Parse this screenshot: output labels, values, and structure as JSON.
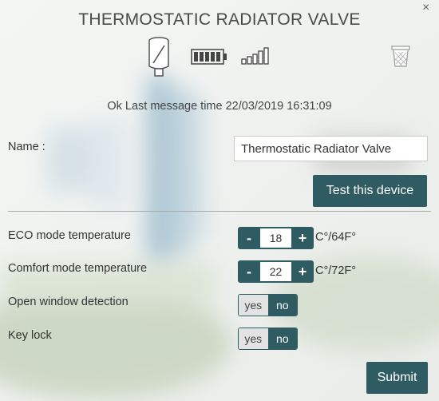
{
  "header": {
    "title": "THERMOSTATIC RADIATOR VALVE",
    "close_glyph": "×"
  },
  "device_icons": {
    "device": "thermostatic-valve-icon",
    "battery": "battery-icon",
    "battery_level": 1.0,
    "signal": "signal-strength-icon",
    "signal_level": 1.0,
    "delete": "trash-icon"
  },
  "status": {
    "text": "Ok Last message time 22/03/2019 16:31:09"
  },
  "name": {
    "label": "Name :",
    "value": "Thermostatic Radiator Valve"
  },
  "test_button": {
    "label": "Test this device"
  },
  "eco": {
    "label": "ECO mode temperature",
    "value": "18",
    "unit": "C°/64F°",
    "minus": "-",
    "plus": "+"
  },
  "comfort": {
    "label": "Comfort mode temperature",
    "value": "22",
    "unit": "C°/72F°",
    "minus": "-",
    "plus": "+"
  },
  "open_window": {
    "label": "Open window detection",
    "yes": "yes",
    "no": "no",
    "selected": "no"
  },
  "key_lock": {
    "label": "Key lock",
    "yes": "yes",
    "no": "no",
    "selected": "no"
  },
  "submit": {
    "label": "Submit"
  },
  "colors": {
    "accent": "#2f5c63",
    "divider": "#a9a9a9"
  }
}
